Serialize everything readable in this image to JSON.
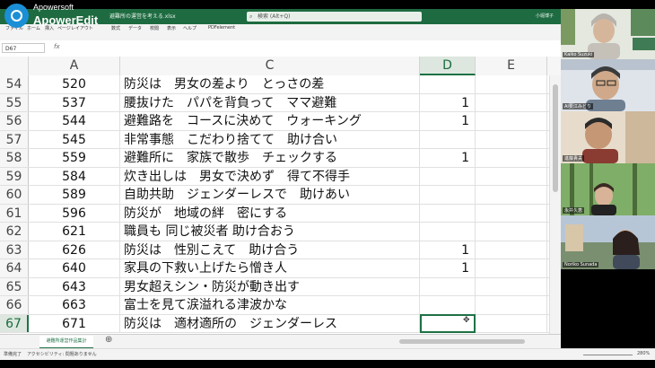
{
  "watermark": {
    "brand": "Apowersoft",
    "product": "ApowerEdit"
  },
  "excel": {
    "file_name": "避難所の運営を考える.xlsx",
    "search_placeholder": "検索 (Alt+Q)",
    "user_name": "小堀博子",
    "menu": [
      "ファイル",
      "ホーム",
      "挿入",
      "ページレイアウト",
      "数式",
      "データ",
      "校閲",
      "表示",
      "ヘルプ",
      "PDFelement"
    ],
    "name_box": "D67",
    "fx": "fx",
    "columns": {
      "rownum": "",
      "a": "A",
      "c": "C",
      "d": "D",
      "e": "E"
    },
    "rows": [
      {
        "n": "54",
        "a": "520",
        "c": "防災は　男女の差より　とっさの差",
        "d": ""
      },
      {
        "n": "55",
        "a": "537",
        "c": "腰抜けた　パパを背負って　ママ避難",
        "d": "1"
      },
      {
        "n": "56",
        "a": "544",
        "c": "避難路を　コースに決めて　ウォーキング",
        "d": "1"
      },
      {
        "n": "57",
        "a": "545",
        "c": "非常事態　こだわり捨てて　助け合い",
        "d": ""
      },
      {
        "n": "58",
        "a": "559",
        "c": "避難所に　家族で散歩　チェックする",
        "d": "1"
      },
      {
        "n": "59",
        "a": "584",
        "c": "炊き出しは　男女で決めず　得て不得手",
        "d": ""
      },
      {
        "n": "60",
        "a": "589",
        "c": "自助共助　ジェンダーレスで　助けあい",
        "d": ""
      },
      {
        "n": "61",
        "a": "596",
        "c": "防災が　地域の絆　密にする",
        "d": ""
      },
      {
        "n": "62",
        "a": "621",
        "c": "職員も 同じ被災者 助け合おう",
        "d": ""
      },
      {
        "n": "63",
        "a": "626",
        "c": "防災は　性別こえて　助け合う",
        "d": "1"
      },
      {
        "n": "64",
        "a": "640",
        "c": "家具の下救い上げたら憎き人",
        "d": "1"
      },
      {
        "n": "65",
        "a": "643",
        "c": "男女超えシン・防災が動き出す",
        "d": ""
      },
      {
        "n": "66",
        "a": "663",
        "c": "富士を見て涙溢れる津波かな",
        "d": ""
      },
      {
        "n": "67",
        "a": "671",
        "c": "防災は　適材適所の　ジェンダーレス",
        "d": ""
      }
    ],
    "sheet_tab": "避難所運営作品集計",
    "status": {
      "ready": "準備完了",
      "accessibility": "アクセシビリティ: 問題ありません",
      "zoom": "280%"
    }
  },
  "participants": [
    {
      "name": "Kaiko Suzuki"
    },
    {
      "name": "AI要江みどり"
    },
    {
      "name": "進藤貴夫"
    },
    {
      "name": "永井久恵"
    },
    {
      "name": "Noriko Sunada"
    }
  ],
  "colors": {
    "excel_green": "#1e7145",
    "titlebar": "#1e6b41",
    "background": "#000000"
  }
}
